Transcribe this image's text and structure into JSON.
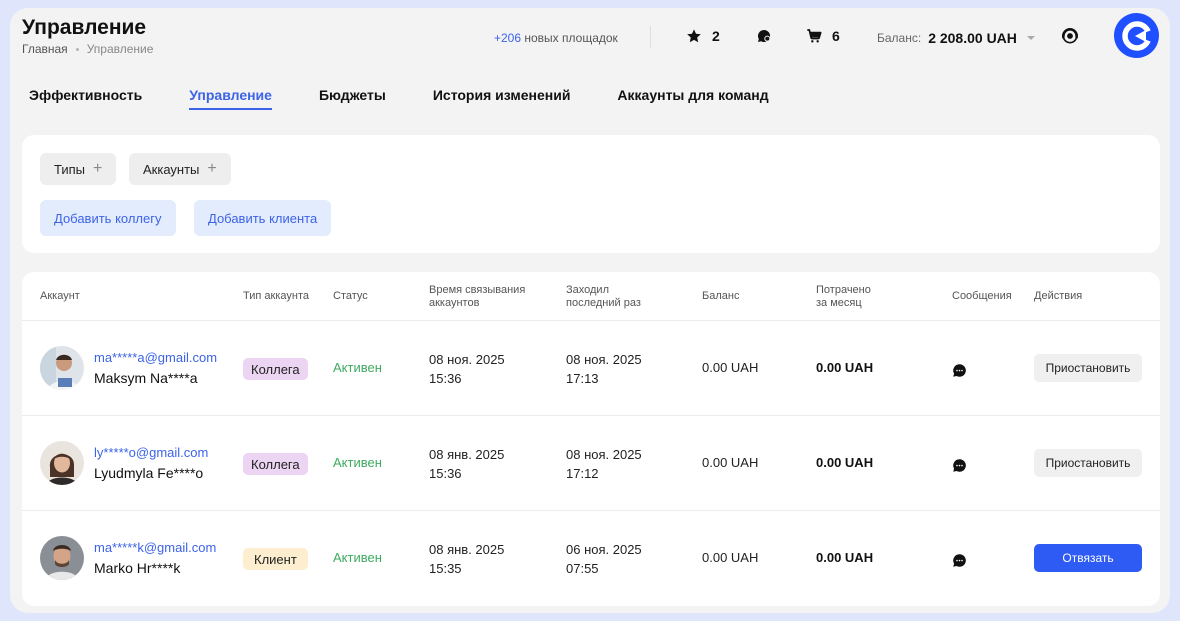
{
  "header": {
    "title": "Управление",
    "breadcrumb": [
      "Главная",
      "Управление"
    ],
    "new_sites_count": "+206",
    "new_sites_text": "новых площадок",
    "favorites_count": "2",
    "cart_count": "6",
    "balance_label": "Баланс:",
    "balance_value": "2 208.00 UAH"
  },
  "tabs": [
    {
      "label": "Эффективность",
      "active": false
    },
    {
      "label": "Управление",
      "active": true
    },
    {
      "label": "Бюджеты",
      "active": false
    },
    {
      "label": "История изменений",
      "active": false
    },
    {
      "label": "Аккаунты для команд",
      "active": false
    }
  ],
  "filters": {
    "types_label": "Типы",
    "accounts_label": "Аккаунты",
    "add_colleague": "Добавить коллегу",
    "add_client": "Добавить клиента"
  },
  "table": {
    "columns": {
      "account": "Аккаунт",
      "type": "Тип аккаунта",
      "status": "Статус",
      "link_time_1": "Время связывания",
      "link_time_2": "аккаунтов",
      "last_seen_1": "Заходил",
      "last_seen_2": "последний раз",
      "balance": "Баланс",
      "spent_1": "Потрачено",
      "spent_2": "за месяц",
      "messages": "Сообщения",
      "actions": "Действия"
    },
    "rows": [
      {
        "email": "ma*****a@gmail.com",
        "name": "Maksym Na****a",
        "type": "Коллега",
        "status": "Активен",
        "link_date": "08 ноя. 2025",
        "link_time": "15:36",
        "seen_date": "08 ноя. 2025",
        "seen_time": "17:13",
        "balance": "0.00 UAH",
        "spent": "0.00 UAH",
        "action": "Приостановить"
      },
      {
        "email": "ly*****o@gmail.com",
        "name": "Lyudmyla Fe****o",
        "type": "Коллега",
        "status": "Активен",
        "link_date": "08 янв. 2025",
        "link_time": "15:36",
        "seen_date": "08 ноя. 2025",
        "seen_time": "17:12",
        "balance": "0.00 UAH",
        "spent": "0.00 UAH",
        "action": "Приостановить"
      },
      {
        "email": "ma*****k@gmail.com",
        "name": "Marko Hr****k",
        "type": "Клиент",
        "status": "Активен",
        "link_date": "08 янв. 2025",
        "link_time": "15:35",
        "seen_date": "06 ноя. 2025",
        "seen_time": "07:55",
        "balance": "0.00 UAH",
        "spent": "0.00 UAH",
        "action": "Отвязать"
      }
    ]
  },
  "colors": {
    "accent": "#3c63e8",
    "primary_button": "#2f5bf5",
    "status_active": "#3dab60",
    "badge_colleague": "#ecd5f3",
    "badge_client": "#fdeed0",
    "logo": "#1f4fff"
  },
  "icons": [
    "star-icon",
    "chat-bubble-icon",
    "cart-icon",
    "support-icon",
    "brand-logo-icon",
    "message-icon"
  ]
}
